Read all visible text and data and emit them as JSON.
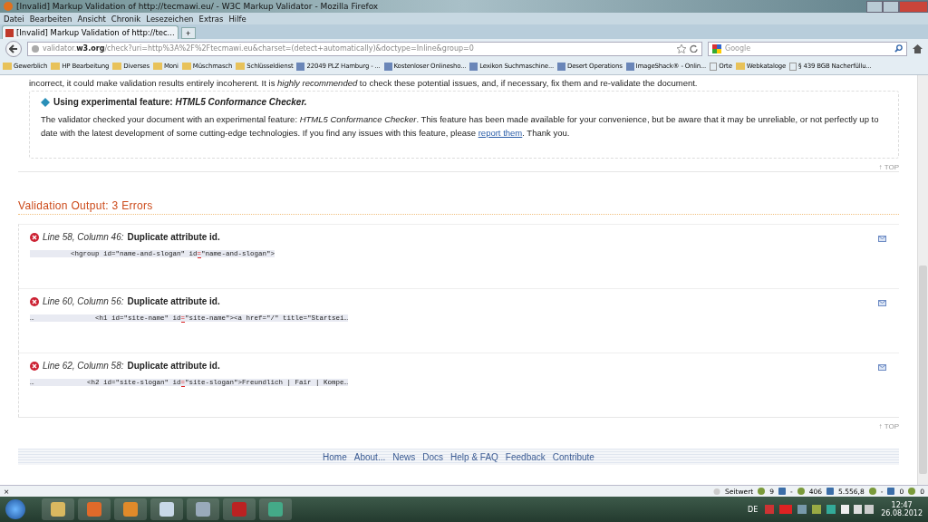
{
  "window": {
    "title": "[Invalid] Markup Validation of http://tecmawi.eu/ - W3C Markup Validator - Mozilla Firefox"
  },
  "menu": [
    "Datei",
    "Bearbeiten",
    "Ansicht",
    "Chronik",
    "Lesezeichen",
    "Extras",
    "Hilfe"
  ],
  "tabs": [
    {
      "label": "[Invalid] Markup Validation of http://tec...",
      "selected": true
    }
  ],
  "new_tab": "+",
  "address": {
    "prefix": "validator.",
    "domain": "w3.org",
    "path": "/check?uri=http%3A%2F%2Ftecmawi.eu&charset=(detect+automatically)&doctype=Inline&group=0"
  },
  "search": {
    "placeholder": "Google"
  },
  "bookmarks": [
    {
      "label": "Gewerblich",
      "kind": "folder"
    },
    {
      "label": "HP Bearbeitung",
      "kind": "folder"
    },
    {
      "label": "Diverses",
      "kind": "folder"
    },
    {
      "label": "Moni",
      "kind": "folder"
    },
    {
      "label": "Müschmasch",
      "kind": "folder"
    },
    {
      "label": "Schlüsseldienst",
      "kind": "folder"
    },
    {
      "label": "22049 PLZ Hamburg - ...",
      "kind": "site"
    },
    {
      "label": "Kostenloser Onlinesho...",
      "kind": "site"
    },
    {
      "label": "Lexikon Suchmaschine...",
      "kind": "site"
    },
    {
      "label": "Desert Operations",
      "kind": "site"
    },
    {
      "label": "ImageShack® - Onlin...",
      "kind": "site"
    },
    {
      "label": "Orte",
      "kind": "page"
    },
    {
      "label": "Webkataloge",
      "kind": "folder"
    },
    {
      "label": "§ 439 BGB Nacherfüllu...",
      "kind": "page"
    }
  ],
  "intro": "incorrect, it could make validation results entirely incoherent. It is *highly recommended* to check these potential issues, and, if necessary, fix them and re-validate the document.",
  "notice": {
    "title": "Using experimental feature: *HTML5 Conformance Checker.*",
    "text": "The validator checked your document with an experimental feature: *HTML5 Conformance Checker*. This feature has been made available for your convenience, but be aware that it may be unreliable, or not perfectly up to date with the latest development of some cutting-edge technologies. If you find any issues with this feature, please",
    "link": "report them",
    "after": ". Thank you."
  },
  "top_links": [
    "↑ TOP",
    "↑ TOP"
  ],
  "output_heading": "Validation Output: 3 Errors",
  "errors": [
    {
      "location": "Line 58, Column 46:",
      "message": "Duplicate attribute id.",
      "code_before": "          <hgroup id=\"name-and-slogan\" id",
      "code_mark": "=",
      "code_after": "\"name-and-slogan\">"
    },
    {
      "location": "Line 60, Column 56:",
      "message": "Duplicate attribute id.",
      "code_before": "               <h1 id=\"site-name\" id",
      "code_mark": "=",
      "code_after": "\"site-name\"><a href=\"/\" title=\"Startsei…",
      "lead": "…"
    },
    {
      "location": "Line 62, Column 58:",
      "message": "Duplicate attribute id.",
      "code_before": "             <h2 id=\"site-slogan\" id",
      "code_mark": "=",
      "code_after": "\"site-slogan\">Freundlich | Fair | Kompe…",
      "lead": "…"
    }
  ],
  "footer_links": [
    "Home",
    "About...",
    "News",
    "Docs",
    "Help & FAQ",
    "Feedback",
    "Contribute"
  ],
  "addon_bar": {
    "close": "×",
    "label": "Seitwert",
    "items": [
      "9",
      "-",
      "406",
      "5.556,8",
      "-",
      "0",
      "0"
    ]
  },
  "taskbar": {
    "language": "DE",
    "time": "12:47",
    "date": "26.08.2012"
  }
}
